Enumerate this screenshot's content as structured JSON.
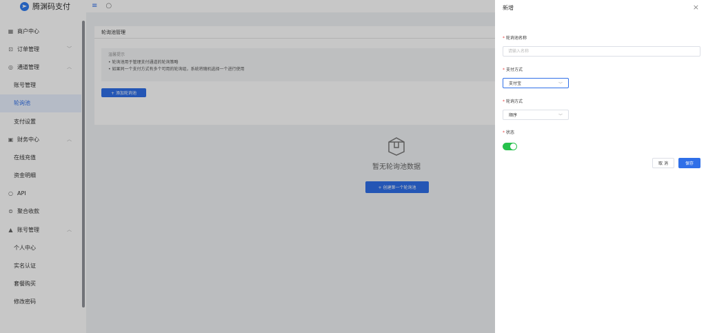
{
  "brand": {
    "name": "腾渊码支付"
  },
  "sidebar": {
    "items": [
      {
        "label": "商户中心",
        "icon": "grid-icon",
        "arrow": ""
      },
      {
        "label": "订单管理",
        "icon": "cart-icon",
        "arrow": "﹀"
      },
      {
        "label": "通道管理",
        "icon": "channel-icon",
        "arrow": "︿"
      },
      {
        "label": "账号管理",
        "sub": true
      },
      {
        "label": "轮询池",
        "sub": true,
        "active": true
      },
      {
        "label": "支付设置",
        "sub": true
      },
      {
        "label": "财务中心",
        "icon": "wallet-icon",
        "arrow": "︿"
      },
      {
        "label": "在线充值",
        "sub": true
      },
      {
        "label": "资金明细",
        "sub": true
      },
      {
        "label": "API",
        "icon": "api-icon",
        "arrow": ""
      },
      {
        "label": "聚合收款",
        "icon": "collect-icon",
        "arrow": ""
      },
      {
        "label": "账号管理",
        "icon": "user-icon",
        "arrow": "︿"
      },
      {
        "label": "个人中心",
        "sub": true
      },
      {
        "label": "实名认证",
        "sub": true
      },
      {
        "label": "套餐购买",
        "sub": true
      },
      {
        "label": "修改密码",
        "sub": true
      }
    ]
  },
  "main": {
    "card_title": "轮询池管理",
    "tip_title": "温馨提示",
    "tip_lines": [
      "• 轮询池用于管理支付通道的轮询策略",
      "• 如果同一个支付方式有多个可用的轮询组，系统将随机选择一个进行使用"
    ],
    "add_button": "+ 添加轮询池",
    "empty_text": "暂无轮询池数据",
    "create_first_button": "+ 创建第一个轮询池"
  },
  "drawer": {
    "title": "新增",
    "close": "×",
    "name_label": "轮询池名称",
    "name_placeholder": "请输入名称",
    "pay_method_label": "支付方式",
    "pay_method_value": "支付宝",
    "poll_mode_label": "轮询方式",
    "poll_mode_value": "顺序",
    "status_label": "状态",
    "status_on": true,
    "cancel": "取 消",
    "save": "保存",
    "required_mark": "*"
  },
  "colors": {
    "primary": "#2f6fe8",
    "toggle_on": "#27c24c",
    "required": "#e64545"
  }
}
